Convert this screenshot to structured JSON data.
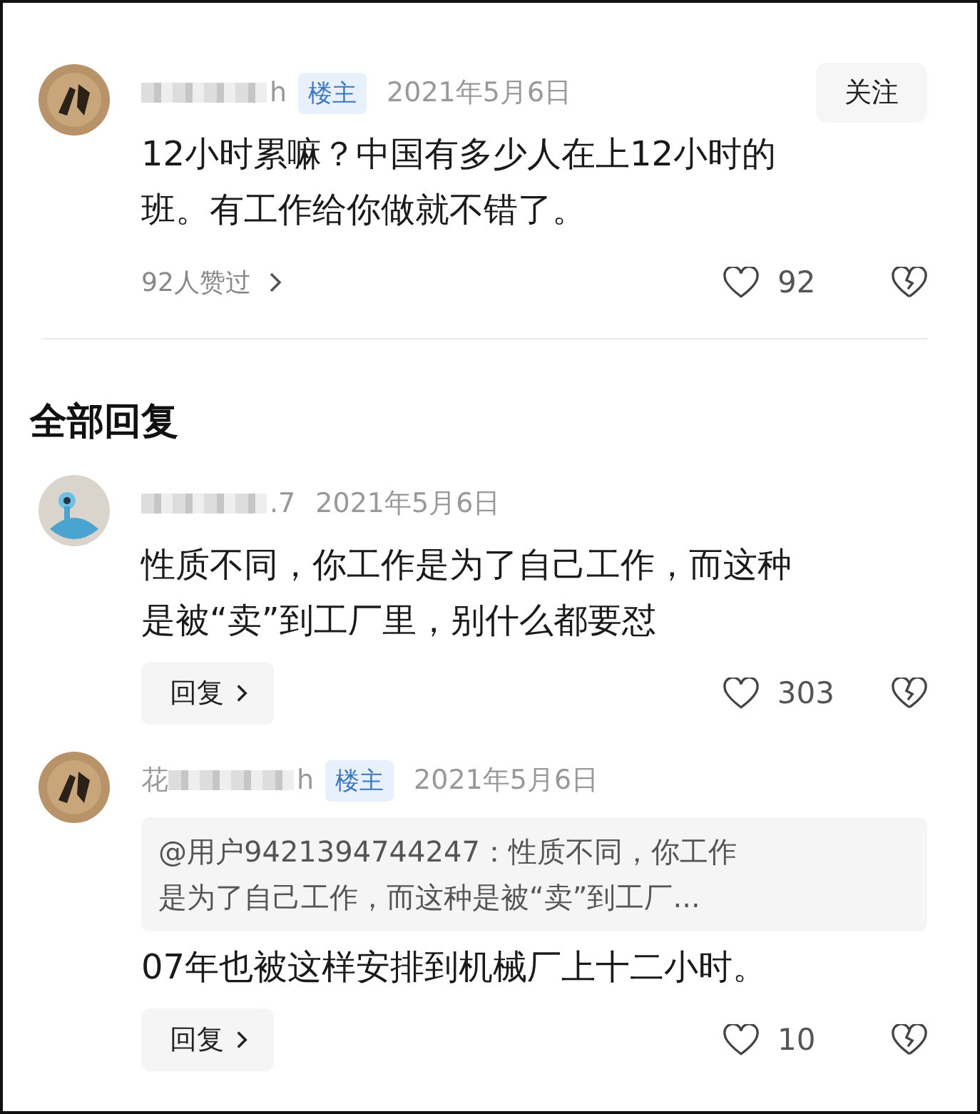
{
  "post": {
    "name_parts": [
      {
        "kind": "mosaic"
      },
      {
        "kind": "text",
        "text": "h"
      }
    ],
    "op_badge": "楼主",
    "date": "2021年5月6日",
    "follow_button": "关注",
    "content": [
      "12小时累嘛？中国有多少人在上12小时的",
      "班。有工作给你做就不错了。"
    ],
    "liked_by": "92人赞过",
    "likes": "92"
  },
  "section_title": "全部回复",
  "replies": [
    {
      "name_parts": [
        {
          "kind": "mosaic"
        },
        {
          "kind": "text",
          "text": ".7"
        }
      ],
      "op": false,
      "date": "2021年5月6日",
      "content": [
        "性质不同，你工作是为了自己工作，而这种",
        "是被“卖”到工厂里，别什么都要怼"
      ],
      "reply_button": "回复",
      "likes": "303"
    },
    {
      "name_parts": [
        {
          "kind": "text",
          "text": "花"
        },
        {
          "kind": "mosaic"
        },
        {
          "kind": "text",
          "text": "h"
        }
      ],
      "op": true,
      "op_badge": "楼主",
      "date": "2021年5月6日",
      "quote": [
        "@用户9421394744247：性质不同，你工作",
        "是为了自己工作，而这种是被“卖”到工厂..."
      ],
      "content": [
        "07年也被这样安排到机械厂上十二小时。"
      ],
      "reply_button": "回复",
      "likes": "10"
    }
  ]
}
